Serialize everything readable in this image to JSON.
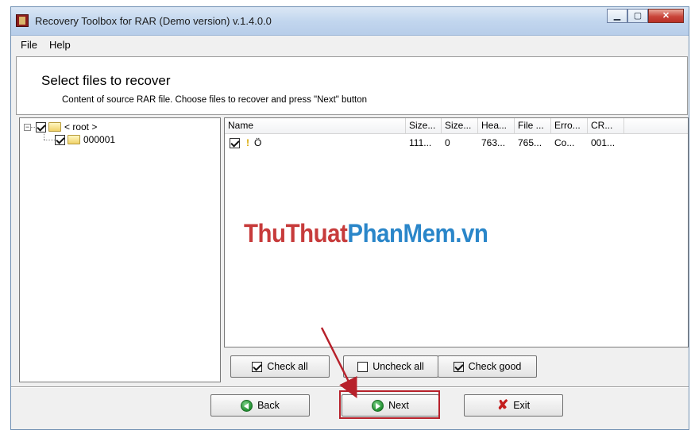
{
  "window": {
    "title": "Recovery Toolbox for RAR (Demo version) v.1.4.0.0",
    "minimize_glyph": "▁",
    "maximize_glyph": "▢",
    "close_glyph": "✕"
  },
  "menu": {
    "file": "File",
    "help": "Help"
  },
  "header": {
    "title": "Select files to recover",
    "subtitle": "Content of source RAR file. Choose files to recover and press \"Next\" button"
  },
  "tree": {
    "root": {
      "expander": "−",
      "label": "< root >",
      "checked": true
    },
    "child": {
      "label": "000001",
      "checked": true
    }
  },
  "list": {
    "columns": [
      "Name",
      "Size...",
      "Size...",
      "Hea...",
      "File ...",
      "Erro...",
      "CR..."
    ],
    "rows": [
      {
        "warning": "!",
        "name": "Ö",
        "cells": [
          "111...",
          "0",
          "763...",
          "765...",
          "Co...",
          "001..."
        ]
      }
    ]
  },
  "buttons": {
    "check_all": "Check all",
    "uncheck_all": "Uncheck all",
    "check_good": "Check good",
    "back": "Back",
    "next": "Next",
    "exit": "Exit",
    "exit_glyph": "✘"
  },
  "watermark": {
    "part1": "ThuThuat",
    "part2": "PhanMem.vn"
  },
  "colors": {
    "highlight": "#b7212b",
    "watermark_red": "#c73b3b",
    "watermark_blue": "#2a86c9"
  }
}
